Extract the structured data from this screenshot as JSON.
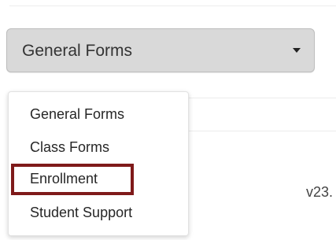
{
  "form_category_select": {
    "selected_value": "General Forms",
    "caret_icon": "caret-down-icon"
  },
  "dropdown": {
    "items": [
      {
        "label": "General Forms"
      },
      {
        "label": "Class Forms"
      },
      {
        "label": "Enrollment"
      },
      {
        "label": "Student Support"
      }
    ],
    "highlighted_item": "Enrollment",
    "highlight_color": "#7f1a1a"
  },
  "background": {
    "version_text": "v23."
  }
}
